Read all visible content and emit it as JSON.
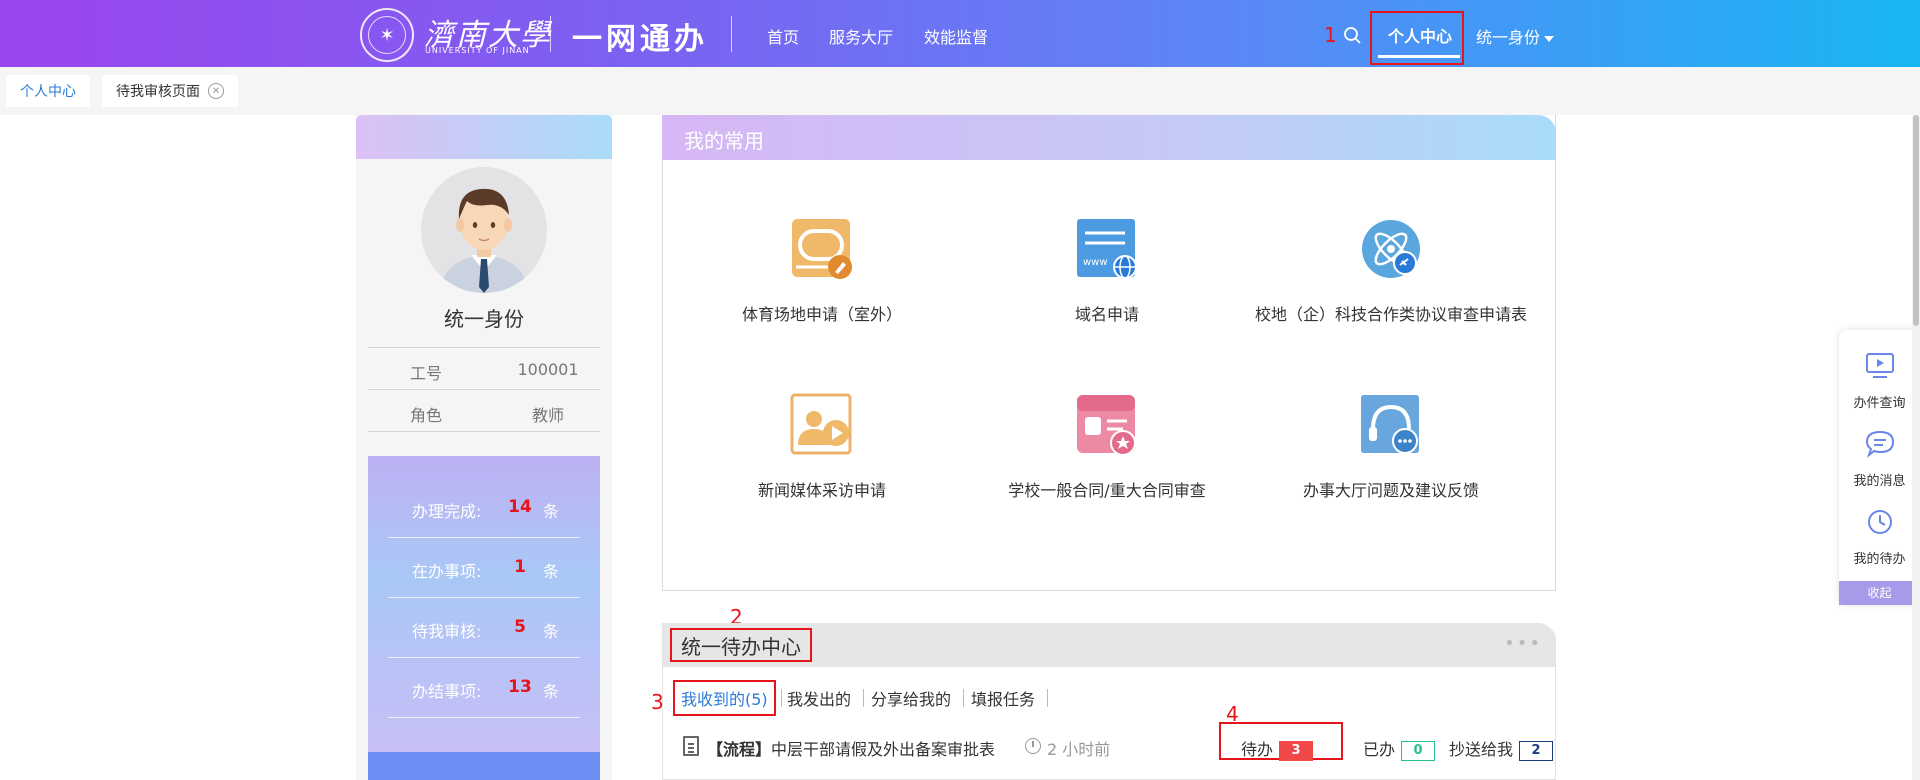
{
  "header": {
    "logo_cn": "濟南大學",
    "logo_en": "UNIVERSITY OF JINAN",
    "brand": "一网通办",
    "nav": [
      "首页",
      "服务大厅",
      "效能监督"
    ],
    "personal_center": "个人中心",
    "identity": "统一身份"
  },
  "annotations": [
    "1",
    "2",
    "3",
    "4"
  ],
  "tabs": [
    {
      "label": "个人中心"
    },
    {
      "label": "待我审核页面"
    }
  ],
  "profile": {
    "name": "统一身份",
    "fields": [
      {
        "key": "工号",
        "value": "100001"
      },
      {
        "key": "角色",
        "value": "教师"
      }
    ],
    "stats": [
      {
        "label": "办理完成:",
        "count": "14",
        "unit": "条"
      },
      {
        "label": "在办事项:",
        "count": "1",
        "unit": "条"
      },
      {
        "label": "待我审核:",
        "count": "5",
        "unit": "条"
      },
      {
        "label": "办结事项:",
        "count": "13",
        "unit": "条"
      }
    ]
  },
  "favorites": {
    "title": "我的常用",
    "items": [
      {
        "name": "体育场地申请（室外）",
        "icon": "stadium-icon",
        "color": "#e8a455"
      },
      {
        "name": "域名申请",
        "icon": "domain-icon",
        "color": "#3a8fd6"
      },
      {
        "name": "校地（企）科技合作类协议审查申请表",
        "icon": "atom-link-icon",
        "color": "#4a9fd8"
      },
      {
        "name": "新闻媒体采访申请",
        "icon": "media-icon",
        "color": "#eaa652"
      },
      {
        "name": "学校一般合同/重大合同审查",
        "icon": "contract-icon",
        "color": "#e46a8c"
      },
      {
        "name": "办事大厅问题及建议反馈",
        "icon": "feedback-icon",
        "color": "#3c84c8"
      }
    ]
  },
  "todo": {
    "title": "统一待办中心",
    "tabs": [
      "我收到的(5)",
      "我发出的",
      "分享给我的",
      "填报任务"
    ],
    "row": {
      "tag": "【流程】",
      "title": "中层干部请假及外出备案审批表",
      "time": "2 小时前",
      "pending_label": "待办",
      "pending_count": "3",
      "done_label": "已办",
      "done_count": "0",
      "cc_label": "抄送给我",
      "cc_count": "2"
    }
  },
  "floatbar": {
    "items": [
      "办件查询",
      "我的消息",
      "我的待办"
    ],
    "collapse": "收起"
  }
}
